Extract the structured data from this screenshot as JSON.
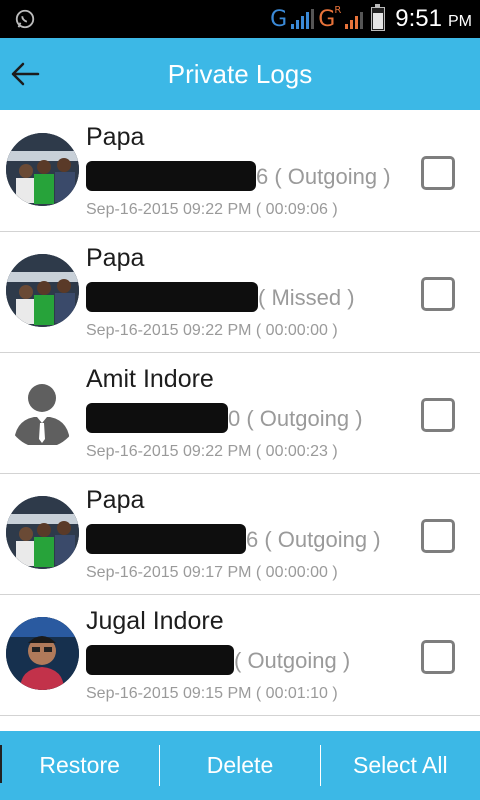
{
  "status_bar": {
    "time": "9:51",
    "ampm": "PM",
    "net1": "G",
    "net2": "G",
    "net2_sup": "R"
  },
  "app_bar": {
    "title": "Private Logs"
  },
  "logs": [
    {
      "name": "Papa",
      "number_tail": "6 ( Outgoing )",
      "timestamp": "Sep-16-2015 09:22 PM ( 00:09:06 )",
      "avatar": "photo"
    },
    {
      "name": "Papa",
      "number_tail": "( Missed )",
      "timestamp": "Sep-16-2015 09:22 PM ( 00:00:00 )",
      "avatar": "photo"
    },
    {
      "name": "Amit Indore",
      "number_tail": "0 ( Outgoing )",
      "timestamp": "Sep-16-2015 09:22 PM ( 00:00:23 )",
      "avatar": "default"
    },
    {
      "name": "Papa",
      "number_tail": "6 ( Outgoing )",
      "timestamp": "Sep-16-2015 09:17 PM ( 00:00:00 )",
      "avatar": "photo"
    },
    {
      "name": "Jugal Indore",
      "number_tail": "( Outgoing )",
      "timestamp": "Sep-16-2015 09:15 PM ( 00:01:10 )",
      "avatar": "photo-jugal"
    }
  ],
  "bottom_bar": {
    "restore": "Restore",
    "delete": "Delete",
    "select_all": "Select All"
  }
}
